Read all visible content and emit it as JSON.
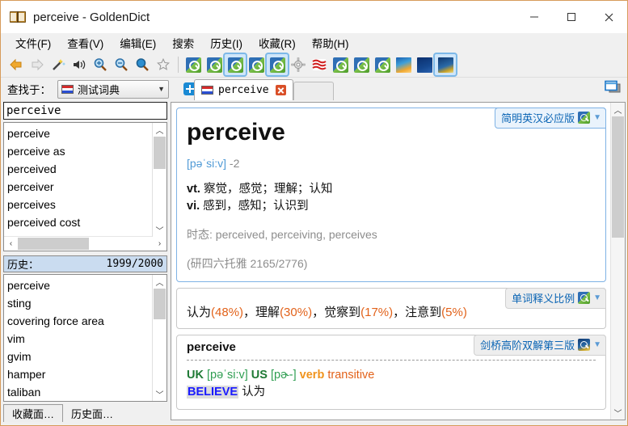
{
  "window": {
    "title": "perceive - GoldenDict",
    "app_icon": "book-icon",
    "minimize": "minimize-icon",
    "maximize": "maximize-icon",
    "close": "close-icon"
  },
  "menu": [
    {
      "label": "文件(F)"
    },
    {
      "label": "查看(V)"
    },
    {
      "label": "编辑(E)"
    },
    {
      "label": "搜索"
    },
    {
      "label": "历史(I)"
    },
    {
      "label": "收藏(R)"
    },
    {
      "label": "帮助(H)"
    }
  ],
  "toolbar": {
    "nav_icons": [
      "back-arrow-icon",
      "forward-arrow-icon",
      "magic-wand-icon",
      "speaker-icon",
      "zoom-in-icon",
      "zoom-out-icon",
      "zoom-reset-icon",
      "star-icon"
    ],
    "group_icons": [
      "dictionary-group-icon",
      "dictionary-group-icon",
      "dictionary-group-icon",
      "dictionary-group-icon",
      "dictionary-group-icon",
      "gear-icon",
      "wave-icon",
      "dictionary-group-icon",
      "dictionary-group-icon",
      "dictionary-group-icon",
      "book-cover-icon",
      "book-cover-icon",
      "book-cover-icon"
    ]
  },
  "lookup": {
    "label": "查找于：",
    "group_value": "测试词典",
    "group_flag": "flag-icon",
    "dropdown_arrow": "chevron-down-icon",
    "add_tab": "plus-icon",
    "window_icon": "window-icon"
  },
  "tabs": [
    {
      "label": "perceive",
      "flag": "flag-icon",
      "close": "close-icon"
    }
  ],
  "search": {
    "value": "perceive",
    "placeholder": ""
  },
  "word_list": [
    {
      "label": "perceive"
    },
    {
      "label": "perceive as"
    },
    {
      "label": "perceived"
    },
    {
      "label": "perceiver"
    },
    {
      "label": "perceives"
    },
    {
      "label": "perceived cost"
    }
  ],
  "history": {
    "title": "历史：",
    "count": "1999/2000",
    "items": [
      {
        "label": "perceive"
      },
      {
        "label": "sting"
      },
      {
        "label": "covering force area"
      },
      {
        "label": "vim"
      },
      {
        "label": "gvim"
      },
      {
        "label": "hamper"
      },
      {
        "label": "taliban"
      }
    ]
  },
  "bottom_tabs": [
    {
      "label": "收藏面…",
      "selected": true
    },
    {
      "label": "历史面…",
      "selected": false
    }
  ],
  "articles": [
    {
      "dict_name": "简明英汉必应版",
      "headword": "perceive",
      "phonetic": "[pəˈsi:v]",
      "phonetic_num": "-2",
      "def_vt_pos": "vt.",
      "def_vt": " 察觉，感觉；理解；认知",
      "def_vi_pos": "vi.",
      "def_vi": " 感到，感知；认识到",
      "tense": "时态: perceived, perceiving, perceives",
      "frequency": "(研四六托雅 2165/2776)"
    },
    {
      "dict_name": "单词释义比例",
      "senses": [
        {
          "gloss": "认为",
          "pct": "(48%)"
        },
        {
          "gloss": "理解",
          "pct": "(30%)"
        },
        {
          "gloss": "觉察到",
          "pct": "(17%)"
        },
        {
          "gloss": "注意到",
          "pct": "(5%)"
        }
      ],
      "separator": "，"
    },
    {
      "dict_name": "剑桥高阶双解第三版",
      "headword": "perceive",
      "uk_label": "UK",
      "uk_ipa": "[pəˈsi:v]",
      "us_label": "US",
      "us_ipa": "[pɚ-]",
      "pos": "verb",
      "transitivity": "transitive",
      "sense_tag": "BELIEVE",
      "sense_cn": "认为"
    }
  ],
  "colors": {
    "accent": "#7fb2e5",
    "title_border": "#d79b5a",
    "pct": "#e2621a",
    "phonetic": "#4f9ad6",
    "dict_name": "#0a64b4"
  }
}
